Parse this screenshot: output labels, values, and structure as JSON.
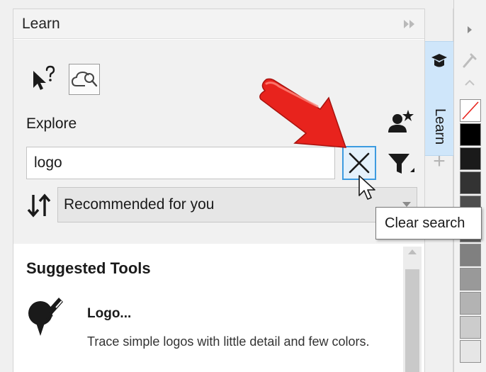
{
  "docker": {
    "title": "Learn",
    "explore_label": "Explore",
    "search": {
      "value": "logo"
    },
    "clear_button_tooltip": "Clear search",
    "sort": {
      "selected": "Recommended for you"
    }
  },
  "results": {
    "section_title": "Suggested Tools",
    "items": [
      {
        "title": "Logo...",
        "description": "Trace simple logos with little detail and few colors."
      }
    ]
  },
  "tabstrip": {
    "active_tab": "Learn"
  },
  "icons": {
    "pin": "fast-forward-icon",
    "close": "close-icon",
    "whats_this": "whats-this-pointer-icon",
    "hints": "cloud-search-icon",
    "add_user": "user-star-icon",
    "filter": "filter-icon",
    "sort": "sort-arrows-icon",
    "trace": "trace-tool-icon",
    "learn_tab": "graduation-cap-icon",
    "cursor": "mouse-pointer-icon",
    "annotation": "red-arrow-callout"
  },
  "colors": {
    "accent_blue": "#3d9be0",
    "active_tab": "#cfe6fa",
    "annotation_red": "#e8231d",
    "palette": [
      "#ffffff",
      "#000000",
      "#1a1a1a",
      "#333333",
      "#4d4d4d",
      "#666666",
      "#808080",
      "#999999",
      "#b3b3b3",
      "#cccccc",
      "#e6e6e6"
    ]
  }
}
